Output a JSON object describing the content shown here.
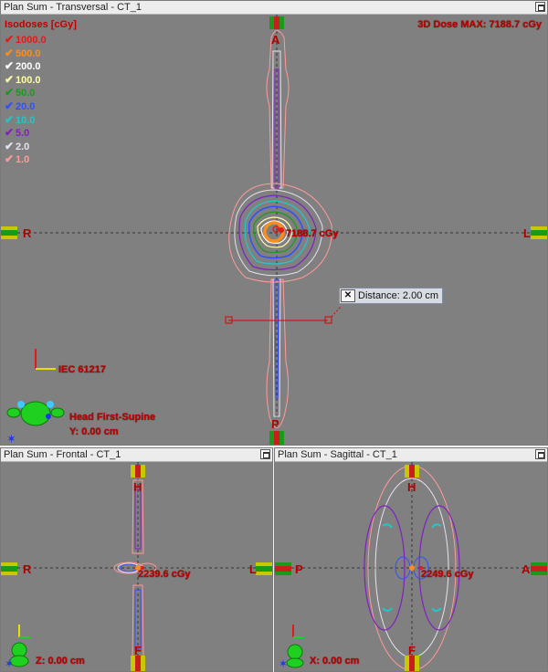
{
  "panels": {
    "transversal": {
      "title": "Plan Sum - Transversal - CT_1",
      "dose_max": "3D Dose MAX: 7188.7 cGy",
      "point_dose": "7188.7 cGy",
      "orientation": {
        "top": "A",
        "bottom": "P",
        "left": "R",
        "right": "L"
      },
      "iec_label": "IEC 61217",
      "patient_position": "Head First-Supine",
      "coordinate": "Y: 0.00 cm",
      "distance_label": "Distance: 2.00 cm",
      "distance_close": "✕"
    },
    "frontal": {
      "title": "Plan Sum - Frontal - CT_1",
      "point_dose": "2239.6 cGy",
      "orientation": {
        "top": "H",
        "bottom": "F",
        "left": "R",
        "right": "L"
      },
      "coordinate": "Z: 0.00 cm"
    },
    "sagittal": {
      "title": "Plan Sum - Sagittal - CT_1",
      "point_dose": "2249.6 cGy",
      "orientation": {
        "top": "H",
        "bottom": "F",
        "left": "P",
        "right": "A"
      },
      "coordinate": "X: 0.00 cm"
    }
  },
  "isodoses": {
    "title": "Isodoses [cGy]",
    "levels": [
      {
        "value": "1000.0",
        "color": "#e31a1a"
      },
      {
        "value": "500.0",
        "color": "#ff8c1a"
      },
      {
        "value": "200.0",
        "color": "#ffffff"
      },
      {
        "value": "100.0",
        "color": "#ffffa0"
      },
      {
        "value": "50.0",
        "color": "#1a9a1a"
      },
      {
        "value": "20.0",
        "color": "#3050ff"
      },
      {
        "value": "10.0",
        "color": "#20c8c8"
      },
      {
        "value": "5.0",
        "color": "#8020c0"
      },
      {
        "value": "2.0",
        "color": "#e8e0f0"
      },
      {
        "value": "1.0",
        "color": "#ff9a9a"
      }
    ]
  }
}
